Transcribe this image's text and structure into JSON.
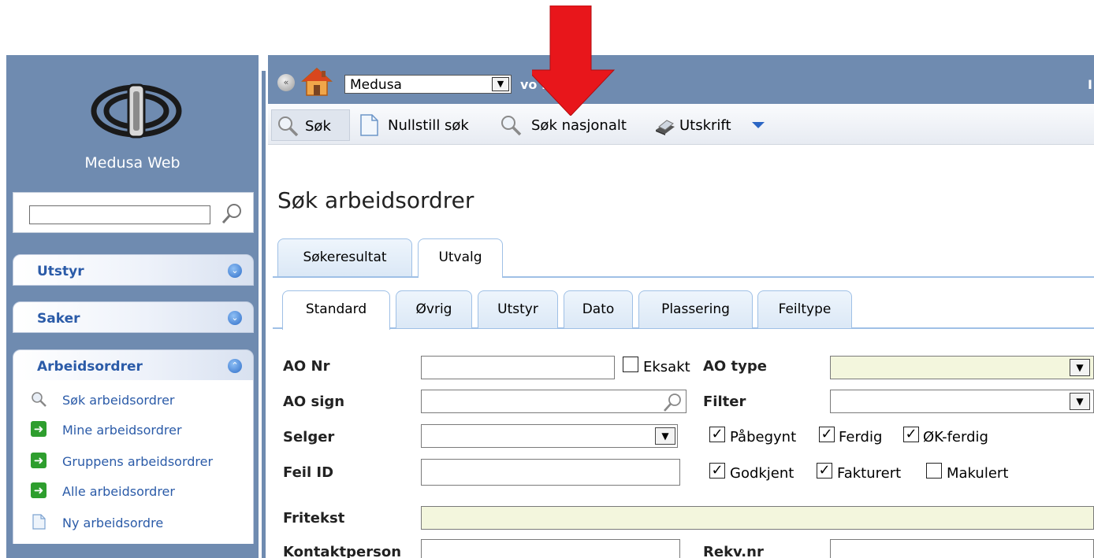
{
  "sidebar": {
    "app_name": "Medusa Web",
    "search": {
      "value": "",
      "placeholder": ""
    },
    "sections": [
      {
        "label": "Utstyr"
      },
      {
        "label": "Saker"
      },
      {
        "label": "Arbeidsordrer"
      }
    ],
    "ao_items": [
      {
        "label": "Søk arbeidsordrer",
        "icon": "search-icon"
      },
      {
        "label": "Mine arbeidsordrer",
        "icon": "green-arrow-icon"
      },
      {
        "label": "Gruppens arbeidsordrer",
        "icon": "green-arrow-icon"
      },
      {
        "label": "Alle arbeidsordrer",
        "icon": "green-arrow-icon"
      },
      {
        "label": "Ny arbeidsordre",
        "icon": "document-icon"
      }
    ]
  },
  "topbar": {
    "database_selected": "Medusa",
    "version_label": "vo        .1"
  },
  "toolbar": {
    "sok": "Søk",
    "nullstill": "Nullstill søk",
    "nasjonalt": "Søk nasjonalt",
    "utskrift": "Utskrift"
  },
  "page": {
    "title": "Søk arbeidsordrer",
    "outer_tabs": [
      "Søkeresultat",
      "Utvalg"
    ],
    "inner_tabs": [
      "Standard",
      "Øvrig",
      "Utstyr",
      "Dato",
      "Plassering",
      "Feiltype"
    ]
  },
  "form": {
    "ao_nr": {
      "label": "AO Nr",
      "value": ""
    },
    "eksakt": {
      "label": "Eksakt",
      "checked": false
    },
    "ao_type": {
      "label": "AO type",
      "value": ""
    },
    "ao_sign": {
      "label": "AO sign",
      "value": ""
    },
    "filter": {
      "label": "Filter",
      "value": ""
    },
    "selger": {
      "label": "Selger",
      "value": ""
    },
    "feil_id": {
      "label": "Feil ID",
      "value": ""
    },
    "fritekst": {
      "label": "Fritekst",
      "value": ""
    },
    "kontaktperson": {
      "label": "Kontaktperson",
      "value": ""
    },
    "rekv_nr": {
      "label": "Rekv.nr",
      "value": ""
    },
    "status_checkboxes": [
      {
        "label": "Påbegynt",
        "checked": true
      },
      {
        "label": "Ferdig",
        "checked": true
      },
      {
        "label": "ØK-ferdig",
        "checked": true
      },
      {
        "label": "Godkjent",
        "checked": true
      },
      {
        "label": "Fakturert",
        "checked": true
      },
      {
        "label": "Makulert",
        "checked": false
      }
    ]
  },
  "colors": {
    "sidebar_bg": "#6f8bb0",
    "link_blue": "#2b5ba8",
    "annotation_red": "#e8161b",
    "field_yellow": "#f3f6dd"
  }
}
